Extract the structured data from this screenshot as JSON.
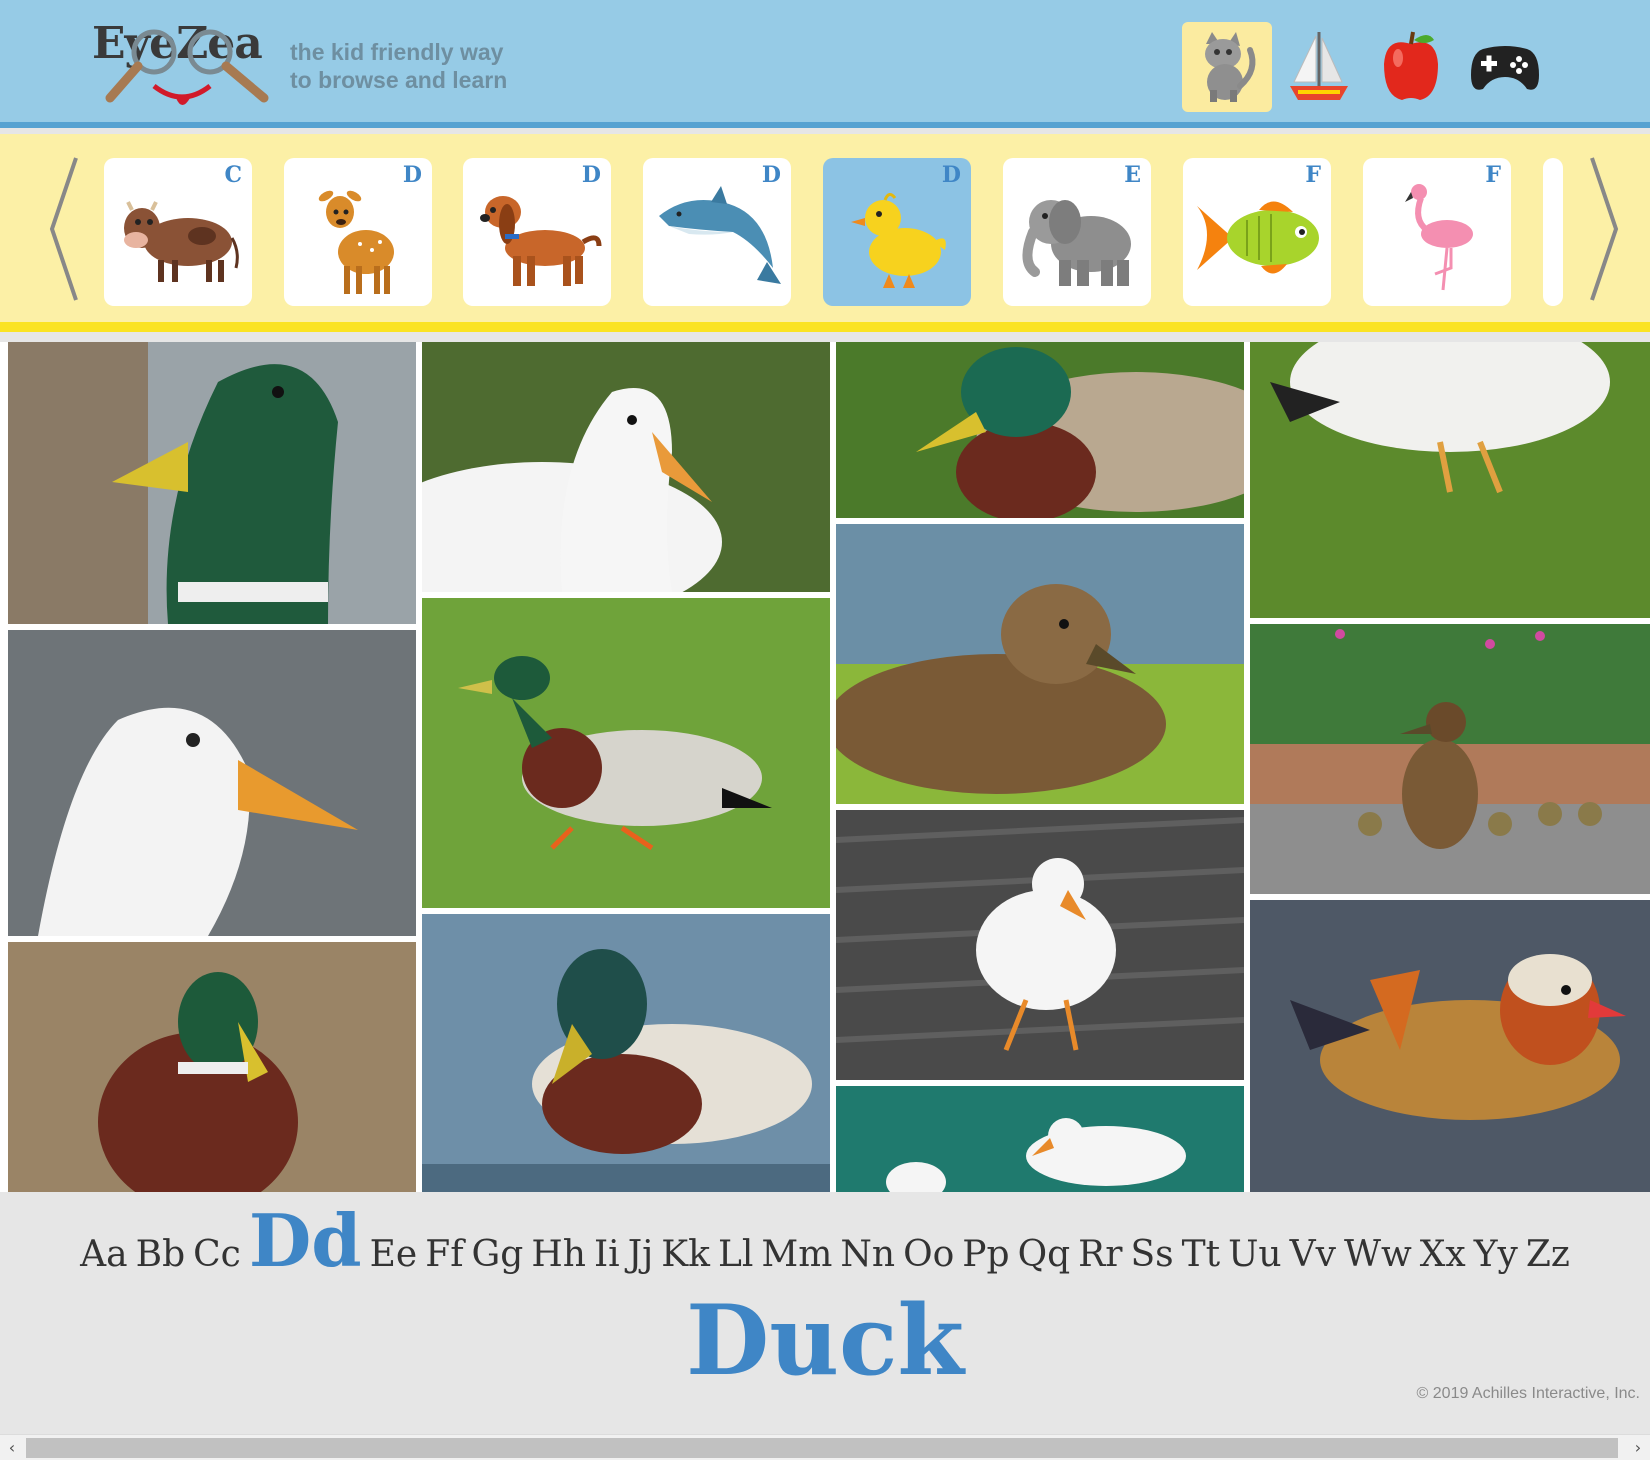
{
  "header": {
    "logo_text": "EyeZea",
    "tagline": "the kid friendly way to browse and learn",
    "nav": [
      {
        "icon": "cat-icon",
        "active": true
      },
      {
        "icon": "sailboat-icon",
        "active": false
      },
      {
        "icon": "apple-icon",
        "active": false
      },
      {
        "icon": "gamepad-icon",
        "active": false
      }
    ]
  },
  "carousel": {
    "cards": [
      {
        "letter": "C",
        "animal": "cow"
      },
      {
        "letter": "D",
        "animal": "deer"
      },
      {
        "letter": "D",
        "animal": "dog"
      },
      {
        "letter": "D",
        "animal": "dolphin"
      },
      {
        "letter": "D",
        "animal": "duck",
        "active": true
      },
      {
        "letter": "E",
        "animal": "elephant"
      },
      {
        "letter": "F",
        "animal": "fish"
      },
      {
        "letter": "F",
        "animal": "flamingo"
      }
    ]
  },
  "gallery": {
    "photos": [
      "mallard-head",
      "white-duck-grass",
      "mallard-in-grass",
      "white-duck-on-lawn",
      "white-duck-portrait",
      "mallard-walking",
      "female-mallard",
      "duck-with-ducklings",
      "mallard-sitting",
      "mallard-swimming",
      "white-duck-on-deck",
      "mandarin-duck",
      "white-ducks-water"
    ]
  },
  "alphabet": [
    "Aa",
    "Bb",
    "Cc",
    "Dd",
    "Ee",
    "Ff",
    "Gg",
    "Hh",
    "Ii",
    "Jj",
    "Kk",
    "Ll",
    "Mm",
    "Nn",
    "Oo",
    "Pp",
    "Qq",
    "Rr",
    "Ss",
    "Tt",
    "Uu",
    "Vv",
    "Ww",
    "Xx",
    "Yy",
    "Zz"
  ],
  "current_word": "Duck",
  "copyright": "© 2019 Achilles Interactive, Inc.",
  "colors": {
    "header_bg": "#96cbe6",
    "carousel_bg": "#fcf0a6",
    "accent_blue": "#3f86c6",
    "accent_yellow": "#fae323"
  }
}
